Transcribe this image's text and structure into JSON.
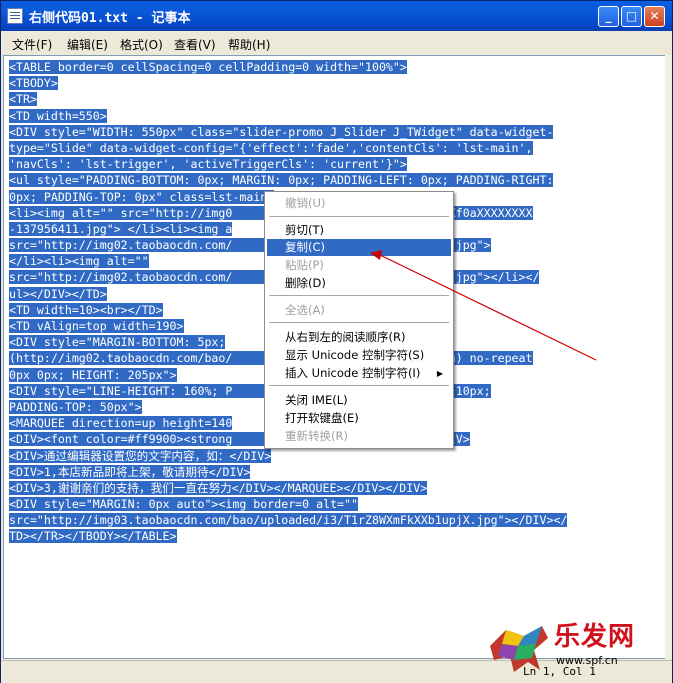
{
  "window": {
    "title": "右侧代码01.txt - 记事本",
    "min_glyph": "_",
    "max_glyph": "□",
    "close_glyph": "✕"
  },
  "menu": [
    {
      "label": "文件(F)"
    },
    {
      "label": "编辑(E)"
    },
    {
      "label": "格式(O)"
    },
    {
      "label": "查看(V)"
    },
    {
      "label": "帮助(H)"
    }
  ],
  "editor": {
    "lines": [
      "<TABLE border=0 cellSpacing=0 cellPadding=0 width=\"100%\">",
      "<TBODY>",
      "<TR>",
      "<TD width=550>",
      "<DIV style=\"WIDTH: 550px\" class=\"slider-promo J_Slider J_TWidget\" data-widget-",
      "type=\"Slide\" data-widget-config=\"{'effect':'fade','contentCls': 'lst-main',",
      "'navCls': 'lst-trigger', 'activeTriggerCls': 'current'}\">",
      "<ul style=\"PADDING-BOTTOM: 0px; MARGIN: 0px; PADDING-LEFT: 0px; PADDING-RIGHT:",
      "0px; PADDING-TOP: 0px\" class=lst-main>",
      "<li><img alt=\"\" src=\"http://img0                    a/i2/T2DSRCXf0aXXXXXXXX",
      "-137956411.jpg\"> </li><li><img a",
      "src=\"http://img02.taobaocdn.com/                    dFkXXb1upjX.jpg\">",
      "</li><li><img alt=\"\"",
      "src=\"http://img02.taobaocdn.com/                    pxjXXb1upjX.jpg\"></li></",
      "ul></DIV></TD>",
      "<TD width=10><br></TD>",
      "<TD vAlign=top width=190>",
      "<DIV style=\"MARGIN-BOTTOM: 5px;",
      "(http://img02.taobaocdn.com/bao/                     XaCwpjX.png) no-repeat",
      "0px 0px; HEIGHT: 205px\">",
      "<DIV style=\"LINE-HEIGHT: 160%; P                     ING-RIGHT: 10px;",
      "PADDING-TOP: 50px\">",
      "<MARQUEE direction=up height=140",
      "<DIV><font color=#ff9900><strong                     </font></DIV>",
      "<DIV>通过编辑器设置您的文字内容，如：</DIV>",
      "<DIV>1,本店新品即将上架，敬请期待</DIV>",
      "<DIV>3,谢谢亲们的支持，我们一直在努力</DIV></MARQUEE></DIV></DIV>",
      "<DIV style=\"MARGIN: 0px auto\"><img border=0 alt=\"\"",
      "src=\"http://img03.taobaocdn.com/bao/uploaded/i3/T1rZ8WXmFkXXb1upjX.jpg\"></DIV></",
      "TD></TR></TBODY></TABLE>"
    ]
  },
  "context_menu": {
    "items": [
      {
        "label": "撤销(U)",
        "disabled": true
      },
      {
        "label": "剪切(T)",
        "disabled": false
      },
      {
        "label": "复制(C)",
        "disabled": false,
        "highlighted": true
      },
      {
        "label": "粘贴(P)",
        "disabled": true
      },
      {
        "label": "删除(D)",
        "disabled": false
      },
      {
        "label": "全选(A)",
        "disabled": true
      },
      {
        "label": "从右到左的阅读顺序(R)",
        "disabled": false
      },
      {
        "label": "显示 Unicode 控制字符(S)",
        "disabled": false
      },
      {
        "label": "插入 Unicode 控制字符(I)",
        "disabled": false,
        "submenu_glyph": "▶"
      },
      {
        "label": "关闭 IME(L)",
        "disabled": false
      },
      {
        "label": "打开软键盘(E)",
        "disabled": false
      },
      {
        "label": "重新转换(R)",
        "disabled": true
      }
    ]
  },
  "status": {
    "position": "Ln 1, Col 1"
  },
  "watermark": {
    "brand": "乐发网",
    "url": "www.spf.cn"
  },
  "colors": {
    "selection": "#316ac5",
    "titlebar": "#0a58d8",
    "annotation_arrow": "#cc0000"
  }
}
